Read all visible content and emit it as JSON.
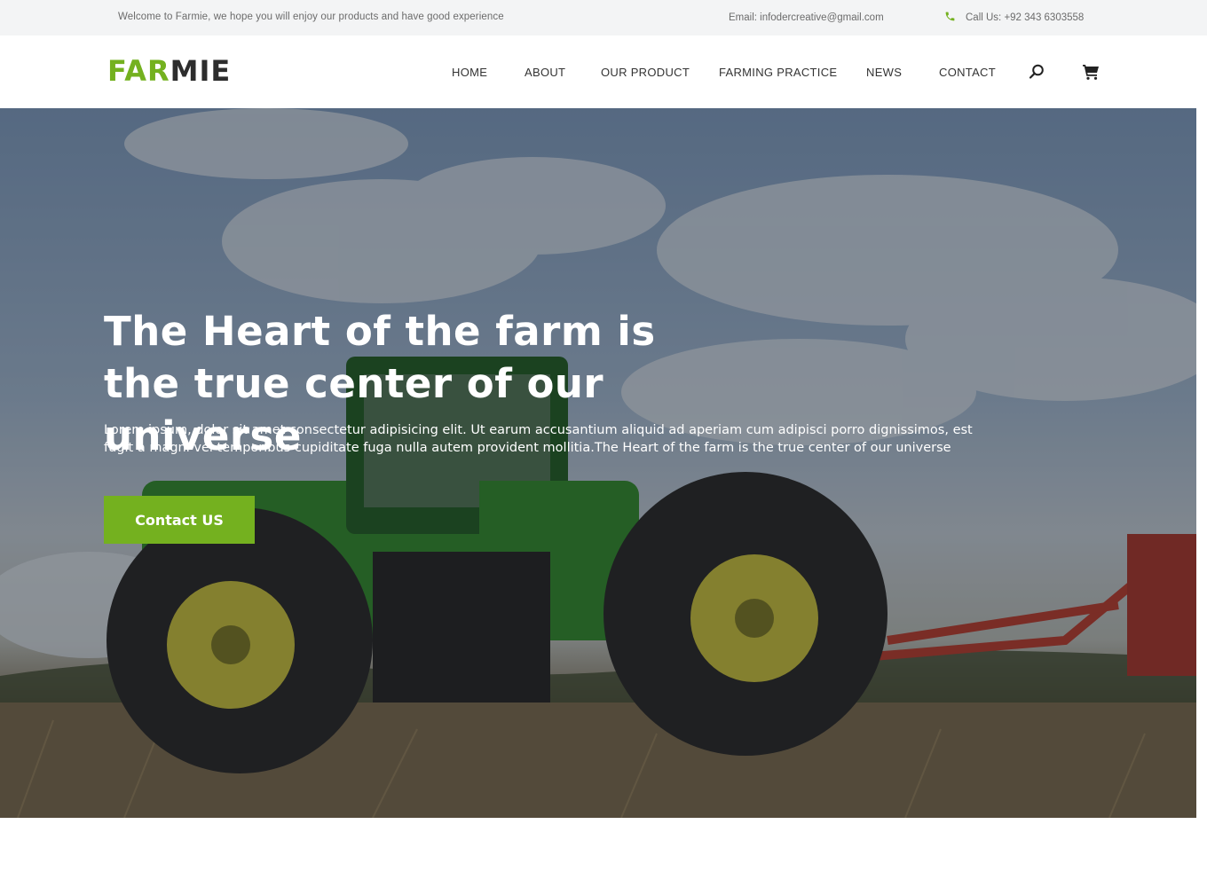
{
  "topbar": {
    "welcome": "Welcome to Farmie, we hope you will enjoy our products and have good experience",
    "email": "Email: infodercreative@gmail.com",
    "phone": "Call Us: +92 343 6303558",
    "phone_icon": "phone-icon"
  },
  "header": {
    "logo_part1": "FAR",
    "logo_part2": "MIE",
    "nav": {
      "home": "HOME",
      "about": "ABOUT",
      "product": "OUR PRODUCT",
      "farming": "FARMING PRACTICE",
      "news": "NEWS",
      "contact": "CONTACT"
    },
    "search_icon": "search-icon",
    "cart_icon": "cart-icon"
  },
  "hero": {
    "title": "The Heart of the farm is the true center of our universe",
    "text": "Lorem ipsum, dolor sit amet consectetur adipisicing elit. Ut earum accusantium aliquid ad aperiam cum adipisci porro dignissimos, est fugit a magni vel temporibus cupiditate fuga nulla autem provident mollitia.The Heart of the farm is the true center of our universe",
    "button": "Contact US"
  },
  "colors": {
    "brand_green": "#74b11f",
    "dark_text": "#2d2d2d",
    "topbar_bg": "#f3f4f5"
  }
}
